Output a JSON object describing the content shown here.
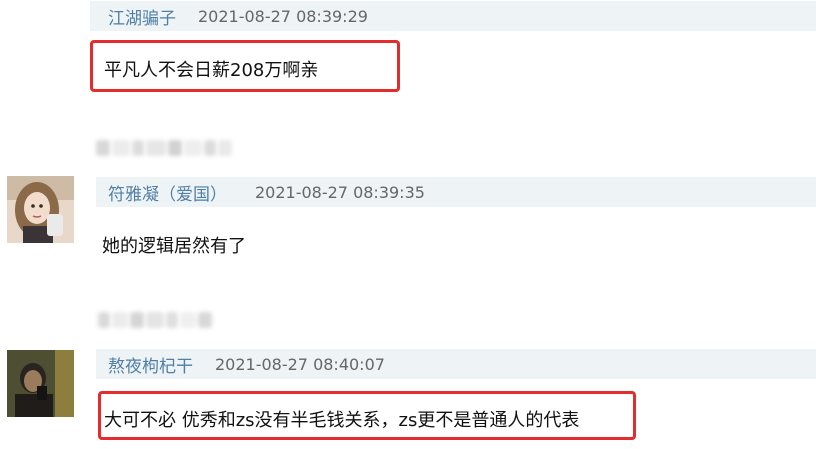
{
  "comments": [
    {
      "author": "江湖骗子",
      "timestamp": "2021-08-27 08:39:29",
      "text": "平凡人不会日薪208万啊亲",
      "highlighted": true
    },
    {
      "author": "符雅凝（爱国）",
      "timestamp": "2021-08-27 08:39:35",
      "text": "她的逻辑居然有了",
      "highlighted": false
    },
    {
      "author": "熬夜枸杞干",
      "timestamp": "2021-08-27 08:40:07",
      "text": "大可不必 优秀和zs没有半毛钱关系，zs更不是普通人的代表",
      "highlighted": true
    }
  ],
  "colors": {
    "author_link": "#4f7fa6",
    "header_bg": "#eef3f6",
    "highlight_border": "#e52c2c",
    "timestamp": "#666666"
  },
  "icons": [
    "female-avatar-image",
    "male-avatar-image",
    "blurred-mosaic"
  ]
}
